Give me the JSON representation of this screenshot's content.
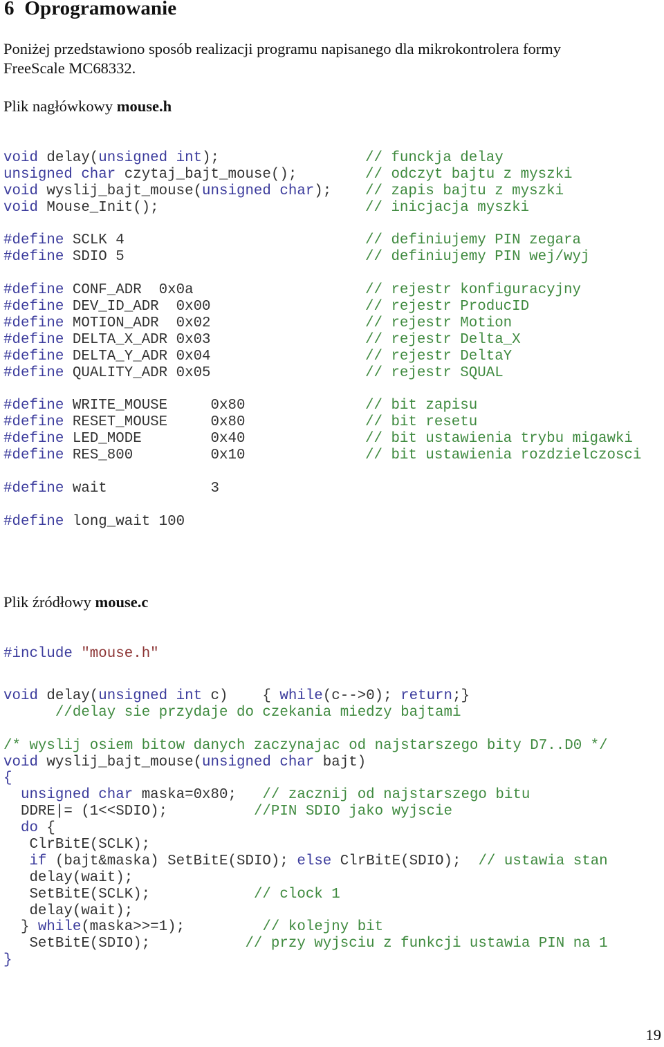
{
  "heading": {
    "number": "6",
    "title": "Oprogramowanie"
  },
  "intro": {
    "line1": "Poniżej przedstawiono sposób realizacji programu napisanego dla mikrokontrolera formy",
    "line2": "FreeScale MC68332."
  },
  "header_file": {
    "label": "Plik nagłówkowy ",
    "filename": "mouse.h",
    "lines": [
      {
        "tokens": [
          {
            "t": "void",
            "c": "kw"
          },
          {
            "t": " delay(",
            "c": "tx"
          },
          {
            "t": "unsigned int",
            "c": "kw"
          },
          {
            "t": ");",
            "c": "tx"
          }
        ],
        "comment": "// funckja delay"
      },
      {
        "tokens": [
          {
            "t": "unsigned char",
            "c": "kw"
          },
          {
            "t": " czytaj_bajt_mouse();",
            "c": "tx"
          }
        ],
        "comment": "// odczyt bajtu z myszki"
      },
      {
        "tokens": [
          {
            "t": "void",
            "c": "kw"
          },
          {
            "t": " wyslij_bajt_mouse(",
            "c": "tx"
          },
          {
            "t": "unsigned char",
            "c": "kw"
          },
          {
            "t": ");",
            "c": "tx"
          }
        ],
        "comment": "// zapis bajtu z myszki"
      },
      {
        "tokens": [
          {
            "t": "void",
            "c": "kw"
          },
          {
            "t": " Mouse_Init();",
            "c": "tx"
          }
        ],
        "comment": "// inicjacja myszki"
      },
      {
        "tokens": [],
        "comment": ""
      },
      {
        "tokens": [
          {
            "t": "#define",
            "c": "pp"
          },
          {
            "t": " SCLK 4",
            "c": "tx"
          }
        ],
        "comment": "// definiujemy PIN zegara"
      },
      {
        "tokens": [
          {
            "t": "#define",
            "c": "pp"
          },
          {
            "t": " SDIO 5",
            "c": "tx"
          }
        ],
        "comment": "// definiujemy PIN wej/wyj"
      },
      {
        "tokens": [],
        "comment": ""
      },
      {
        "tokens": [
          {
            "t": "#define",
            "c": "pp"
          },
          {
            "t": " CONF_ADR  0x0a",
            "c": "tx"
          }
        ],
        "comment": "// rejestr konfiguracyjny"
      },
      {
        "tokens": [
          {
            "t": "#define",
            "c": "pp"
          },
          {
            "t": " DEV_ID_ADR  0x00",
            "c": "tx"
          }
        ],
        "comment": "// rejestr ProducID"
      },
      {
        "tokens": [
          {
            "t": "#define",
            "c": "pp"
          },
          {
            "t": " MOTION_ADR  0x02",
            "c": "tx"
          }
        ],
        "comment": "// rejestr Motion"
      },
      {
        "tokens": [
          {
            "t": "#define",
            "c": "pp"
          },
          {
            "t": " DELTA_X_ADR 0x03",
            "c": "tx"
          }
        ],
        "comment": "// rejestr Delta_X"
      },
      {
        "tokens": [
          {
            "t": "#define",
            "c": "pp"
          },
          {
            "t": " DELTA_Y_ADR 0x04",
            "c": "tx"
          }
        ],
        "comment": "// rejestr DeltaY"
      },
      {
        "tokens": [
          {
            "t": "#define",
            "c": "pp"
          },
          {
            "t": " QUALITY_ADR 0x05",
            "c": "tx"
          }
        ],
        "comment": "// rejestr SQUAL"
      },
      {
        "tokens": [],
        "comment": ""
      },
      {
        "tokens": [
          {
            "t": "#define",
            "c": "pp"
          },
          {
            "t": " WRITE_MOUSE     0x80",
            "c": "tx"
          }
        ],
        "comment": "// bit zapisu"
      },
      {
        "tokens": [
          {
            "t": "#define",
            "c": "pp"
          },
          {
            "t": " RESET_MOUSE     0x80",
            "c": "tx"
          }
        ],
        "comment": "// bit resetu"
      },
      {
        "tokens": [
          {
            "t": "#define",
            "c": "pp"
          },
          {
            "t": " LED_MODE        0x40",
            "c": "tx"
          }
        ],
        "comment": "// bit ustawienia trybu migawki"
      },
      {
        "tokens": [
          {
            "t": "#define",
            "c": "pp"
          },
          {
            "t": " RES_800         0x10",
            "c": "tx"
          }
        ],
        "comment": "// bit ustawienia rozdzielczosci"
      },
      {
        "tokens": [],
        "comment": ""
      },
      {
        "tokens": [
          {
            "t": "#define",
            "c": "pp"
          },
          {
            "t": " wait            3",
            "c": "tx"
          }
        ],
        "comment": ""
      },
      {
        "tokens": [],
        "comment": ""
      },
      {
        "tokens": [
          {
            "t": "#define",
            "c": "pp"
          },
          {
            "t": " long_wait 100",
            "c": "tx"
          }
        ],
        "comment": ""
      }
    ]
  },
  "source_file": {
    "label": "Plik źródłowy ",
    "filename": "mouse.c",
    "include_line": [
      {
        "t": "#include",
        "c": "pp"
      },
      {
        "t": " ",
        "c": "tx"
      },
      {
        "t": "\"mouse.h\"",
        "c": "str"
      }
    ],
    "lines": [
      {
        "tokens": [
          {
            "t": "void",
            "c": "kw"
          },
          {
            "t": " delay(",
            "c": "tx"
          },
          {
            "t": "unsigned int",
            "c": "kw"
          },
          {
            "t": " c)    { ",
            "c": "tx"
          },
          {
            "t": "while",
            "c": "kw"
          },
          {
            "t": "(c-->0); ",
            "c": "tx"
          },
          {
            "t": "return",
            "c": "kw"
          },
          {
            "t": ";}",
            "c": "tx"
          }
        ],
        "comment": "",
        "comment_col": 0
      },
      {
        "tokens": [
          {
            "t": "      ",
            "c": "tx"
          },
          {
            "t": "//delay sie przydaje do czekania miedzy bajtami",
            "c": "cm"
          }
        ],
        "comment": "",
        "comment_col": 0
      },
      {
        "tokens": [],
        "comment": "",
        "comment_col": 0
      },
      {
        "tokens": [
          {
            "t": "/* wyslij osiem bitow danych zaczynajac od najstarszego bity D7..D0 */",
            "c": "cm"
          }
        ],
        "comment": "",
        "comment_col": 0
      },
      {
        "tokens": [
          {
            "t": "void",
            "c": "kw"
          },
          {
            "t": " wyslij_bajt_mouse(",
            "c": "tx"
          },
          {
            "t": "unsigned char",
            "c": "kw"
          },
          {
            "t": " bajt)",
            "c": "tx"
          }
        ],
        "comment": "",
        "comment_col": 0
      },
      {
        "tokens": [
          {
            "t": "{",
            "c": "kw"
          }
        ],
        "comment": "",
        "comment_col": 0
      },
      {
        "tokens": [
          {
            "t": "  ",
            "c": "tx"
          },
          {
            "t": "unsigned char",
            "c": "kw"
          },
          {
            "t": " maska=0x80;   ",
            "c": "tx"
          },
          {
            "t": "// zacznij od najstarszego bitu",
            "c": "cm"
          }
        ],
        "comment": "",
        "comment_col": 0
      },
      {
        "tokens": [
          {
            "t": "  DDRE|= (1<<SDIO);          ",
            "c": "tx"
          },
          {
            "t": "//PIN SDIO jako wyjscie",
            "c": "cm"
          }
        ],
        "comment": "",
        "comment_col": 0
      },
      {
        "tokens": [
          {
            "t": "  ",
            "c": "tx"
          },
          {
            "t": "do",
            "c": "kw"
          },
          {
            "t": " {",
            "c": "tx"
          }
        ],
        "comment": "",
        "comment_col": 0
      },
      {
        "tokens": [
          {
            "t": "   ClrBitE(SCLK);",
            "c": "tx"
          }
        ],
        "comment": "",
        "comment_col": 0
      },
      {
        "tokens": [
          {
            "t": "   ",
            "c": "tx"
          },
          {
            "t": "if",
            "c": "kw"
          },
          {
            "t": " (bajt&maska) SetBitE(SDIO); ",
            "c": "tx"
          },
          {
            "t": "else",
            "c": "kw"
          },
          {
            "t": " ClrBitE(SDIO);  ",
            "c": "tx"
          },
          {
            "t": "// ustawia stan",
            "c": "cm"
          }
        ],
        "comment": "",
        "comment_col": 0
      },
      {
        "tokens": [
          {
            "t": "   delay(wait);",
            "c": "tx"
          }
        ],
        "comment": "",
        "comment_col": 0
      },
      {
        "tokens": [
          {
            "t": "   SetBitE(SCLK);            ",
            "c": "tx"
          },
          {
            "t": "// clock 1",
            "c": "cm"
          }
        ],
        "comment": "",
        "comment_col": 0
      },
      {
        "tokens": [
          {
            "t": "   delay(wait);",
            "c": "tx"
          }
        ],
        "comment": "",
        "comment_col": 0
      },
      {
        "tokens": [
          {
            "t": "  } ",
            "c": "tx"
          },
          {
            "t": "while",
            "c": "kw"
          },
          {
            "t": "(maska>>=1);         ",
            "c": "tx"
          },
          {
            "t": "// kolejny bit",
            "c": "cm"
          }
        ],
        "comment": "",
        "comment_col": 0
      },
      {
        "tokens": [
          {
            "t": "   SetBitE(SDIO);           ",
            "c": "tx"
          },
          {
            "t": "// przy wyjsciu z funkcji ustawia PIN na 1",
            "c": "cm"
          }
        ],
        "comment": "",
        "comment_col": 0
      },
      {
        "tokens": [
          {
            "t": "}",
            "c": "kw"
          }
        ],
        "comment": "",
        "comment_col": 0
      }
    ]
  },
  "page_number": "19"
}
